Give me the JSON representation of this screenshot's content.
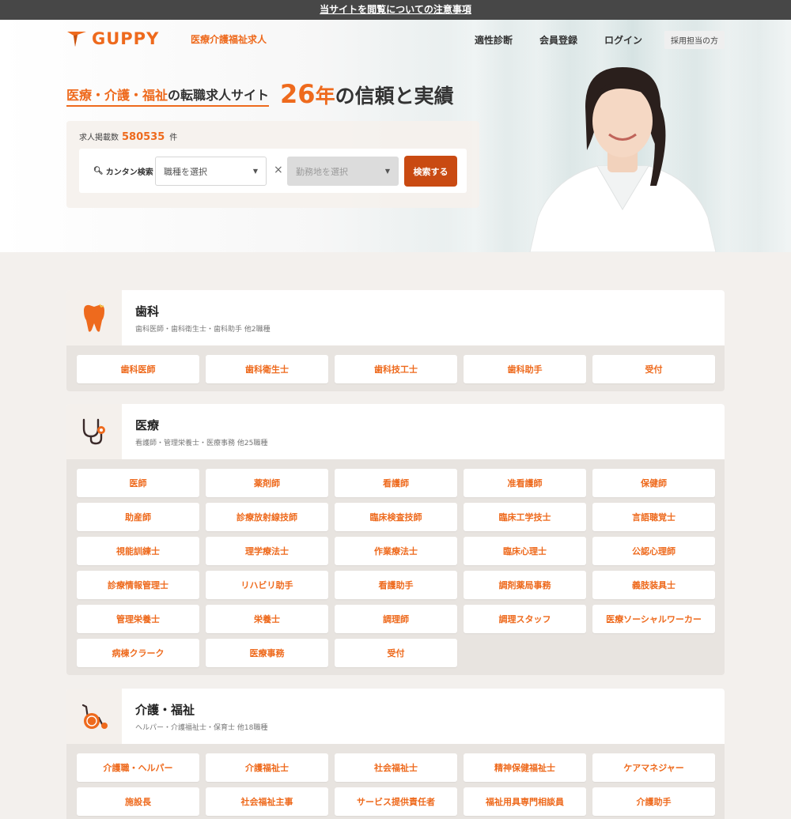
{
  "notice": "当サイトを閲覧についての注意事項",
  "header": {
    "logo_text": "GUPPY",
    "logo_sub": "医療介護福祉求人",
    "nav": [
      "適性診断",
      "会員登録",
      "ログイン"
    ],
    "employer": "採用担当の方"
  },
  "hero": {
    "tag_orange": "医療・介護・福祉",
    "tag_black": "の転職求人サイト",
    "tag_num": "26",
    "tag_unit": "年",
    "tag_rest": "の信頼と実績",
    "count_label": "求人掲載数",
    "count_value": "580535",
    "count_unit": "件",
    "easy_search": "カンタン検索",
    "job_select": "職種を選択",
    "area_select": "勤務地を選択",
    "times": "×",
    "search_button": "検索する"
  },
  "sections": [
    {
      "title": "歯科",
      "sub": "歯科医師・歯科衛生士・歯科助手 他2職種",
      "jobs": [
        "歯科医師",
        "歯科衛生士",
        "歯科技工士",
        "歯科助手",
        "受付"
      ]
    },
    {
      "title": "医療",
      "sub": "看護師・管理栄養士・医療事務 他25職種",
      "jobs": [
        "医師",
        "薬剤師",
        "看護師",
        "准看護師",
        "保健師",
        "助産師",
        "診療放射線技師",
        "臨床検査技師",
        "臨床工学技士",
        "言語聴覚士",
        "視能訓練士",
        "理学療法士",
        "作業療法士",
        "臨床心理士",
        "公認心理師",
        "診療情報管理士",
        "リハビリ助手",
        "看護助手",
        "調剤薬局事務",
        "義肢装具士",
        "管理栄養士",
        "栄養士",
        "調理師",
        "調理スタッフ",
        "医療ソーシャルワーカー",
        "病棟クラーク",
        "医療事務",
        "受付"
      ]
    },
    {
      "title": "介護・福祉",
      "sub": "ヘルパー・介護福祉士・保育士 他18職種",
      "jobs": [
        "介護職・ヘルパー",
        "介護福祉士",
        "社会福祉士",
        "精神保健福祉士",
        "ケアマネジャー",
        "施設長",
        "社会福祉主事",
        "サービス提供責任者",
        "福祉用具専門相談員",
        "介護助手"
      ]
    }
  ],
  "colors": {
    "accent": "#ee6a1d",
    "button": "#c94a12"
  }
}
